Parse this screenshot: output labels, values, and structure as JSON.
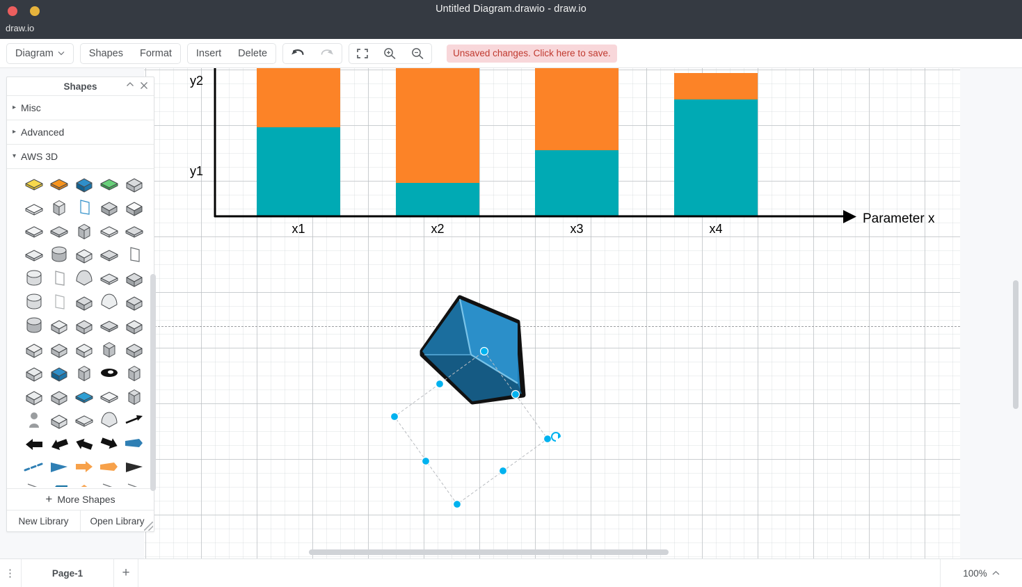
{
  "window": {
    "title": "Untitled Diagram.drawio - draw.io",
    "app_name": "draw.io",
    "close_label": "close-button",
    "minimize_label": "minimize-button"
  },
  "toolbar": {
    "diagram_label": "Diagram",
    "diagram_caret": "⌄",
    "shapes_label": "Shapes",
    "format_label": "Format",
    "insert_label": "Insert",
    "delete_label": "Delete",
    "undo_label": "undo-icon",
    "redo_label": "redo-icon",
    "fullscreen_label": "fullscreen-icon",
    "zoom_in_label": "zoom-in-icon",
    "zoom_out_label": "zoom-out-icon",
    "unsaved_message": "Unsaved changes. Click here to save."
  },
  "shapes_panel": {
    "title": "Shapes",
    "collapse_icon": "˄",
    "close_icon": "×",
    "sections": [
      {
        "label": "Misc",
        "expanded": false
      },
      {
        "label": "Advanced",
        "expanded": false
      },
      {
        "label": "AWS 3D",
        "expanded": true
      }
    ],
    "more_shapes_label": "More Shapes",
    "more_shapes_icon": "+",
    "new_library_label": "New Library",
    "open_library_label": "Open Library",
    "palette_items": [
      "gold-bar-3d",
      "orange-tray-3d",
      "blue-cube-3d",
      "green-slab-3d",
      "grey-cube-3d",
      "grey-screen-3d",
      "grey-rack-3d",
      "blue-document-3d",
      "grey-wedge-3d",
      "grey-open-cube-3d",
      "grey-flat-box-3d",
      "grey-chip-box-3d",
      "grey-pillars-3d",
      "grey-thin-slab-3d",
      "grey-gear-slab-3d",
      "grey-package-slab-3d",
      "grey-drum-3d",
      "grey-dome-cube-3d",
      "grey-quad-blocks-3d",
      "grey-tag-3d",
      "grey-cylinder-3d",
      "white-page-3d",
      "grey-bell-3d",
      "grey-grid-panel-3d",
      "grey-wedge2-3d",
      "grey-disk-3d",
      "white-sheet-3d",
      "grey-cube-red-3d",
      "grey-dome-red-3d",
      "grey-cube-red2-3d",
      "grey-cylinder2-3d",
      "grey-blocks-3d",
      "grey-cube-mark-3d",
      "grey-folder-3d",
      "grey-cube-dark-3d",
      "grey-cube-plain-3d",
      "grey-cube-text-3d",
      "grey-cube-note-3d",
      "grey-bundle-3d",
      "grey-thick-cube-3d",
      "grey-crate-3d",
      "blue-cube-solid-3d",
      "grey-tower-3d",
      "black-disc-3d",
      "grey-tower2-3d",
      "grey-mesh-cube-3d",
      "grey-split-cube-3d",
      "blue-slab-3d",
      "grey-open-tray-3d",
      "grey-tall-cube-3d",
      "grey-person-3d",
      "grey-panels-3d",
      "grey-ring-slab-3d",
      "grey-pentagon-3d",
      "black-arrow-ne",
      "black-arrow-sw",
      "black-arrow-w",
      "black-arrow-nw",
      "black-arrow-se",
      "blue-ribbon-arrow",
      "blue-dashed-arrow",
      "blue-small-arrow",
      "orange-arrow-block",
      "orange-ribbon",
      "black-triangle-arrow",
      "thin-zigzag-arrow",
      "blue-pentagon-solid",
      "orange-diamond",
      "sample-edge-1",
      "sample-edge-2"
    ]
  },
  "canvas": {
    "page_break_label": "page-break-line",
    "selected_shape": "blue-3d-cube",
    "rotation_handle": "↻"
  },
  "chart_data": {
    "type": "bar",
    "subtype": "stacked",
    "title": "",
    "xlabel": "Parameter x",
    "ylabel": "",
    "categories": [
      "x1",
      "x2",
      "x3",
      "x4"
    ],
    "y_tick_labels": [
      "y1",
      "y2"
    ],
    "y_tick_values": [
      1,
      2
    ],
    "ylim": [
      0,
      2.6
    ],
    "grid": true,
    "legend": "none",
    "series": [
      {
        "name": "lower",
        "color": "#00aab4",
        "values": [
          1.23,
          0.45,
          0.88,
          1.6
        ]
      },
      {
        "name": "upper",
        "color": "#fc8327",
        "values": [
          0.77,
          1.78,
          1.12,
          0.43
        ]
      }
    ],
    "series_colors": {
      "lower": "#00aab4",
      "upper": "#fc8327"
    },
    "axis_color": "#000000"
  },
  "footer": {
    "menu_icon": "⋮",
    "page_tab_label": "Page-1",
    "add_page_icon": "+",
    "zoom_label": "100%",
    "zoom_caret": "˄"
  }
}
